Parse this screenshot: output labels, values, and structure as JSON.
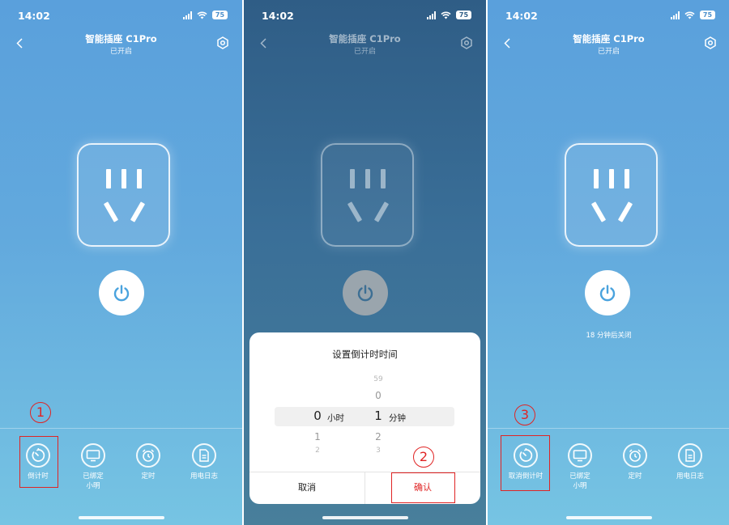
{
  "status": {
    "time": "14:02",
    "battery": "75"
  },
  "header": {
    "title": "智能插座 C1Pro",
    "subtitle": "已开启"
  },
  "countdown_status": "18 分钟后关闭",
  "bottom_bar": {
    "timer_label": "倒计时",
    "cancel_timer_label": "取消倒计时",
    "bind_label_line1": "已绑定",
    "bind_label_line2": "小明",
    "schedule_label": "定时",
    "log_label": "用电日志"
  },
  "dialog": {
    "title": "设置倒计时时间",
    "hours": {
      "prev": [],
      "selected": "0",
      "next": [
        "1",
        "2"
      ],
      "unit": "小时"
    },
    "minutes": {
      "prev": [
        "59",
        "0"
      ],
      "selected": "1",
      "next": [
        "2",
        "3"
      ],
      "unit": "分钟"
    },
    "cancel_label": "取消",
    "confirm_label": "确认"
  },
  "annotations": {
    "step1": "1",
    "step2": "2",
    "step3": "3"
  },
  "colors": {
    "annotation_red": "#e02424",
    "power_icon_blue": "#4aa3de"
  }
}
